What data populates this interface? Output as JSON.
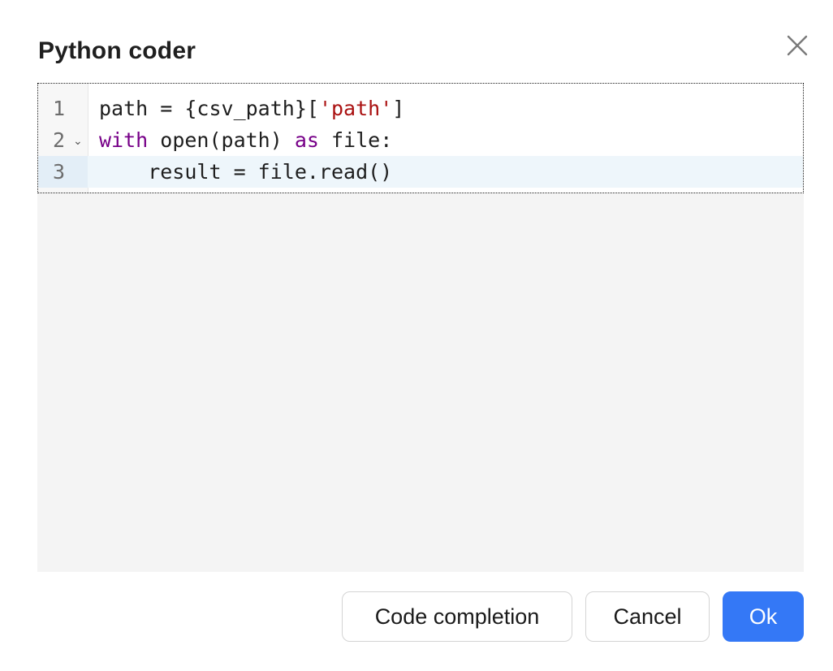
{
  "dialog": {
    "title": "Python coder",
    "close_icon": "close-icon"
  },
  "editor": {
    "active_line": 3,
    "lines": [
      {
        "number": "1",
        "foldable": false,
        "tokens": [
          {
            "text": "path = {csv_path}[",
            "type": "plain"
          },
          {
            "text": "'path'",
            "type": "string"
          },
          {
            "text": "]",
            "type": "plain"
          }
        ]
      },
      {
        "number": "2",
        "foldable": true,
        "tokens": [
          {
            "text": "with",
            "type": "keyword"
          },
          {
            "text": " open(path) ",
            "type": "plain"
          },
          {
            "text": "as",
            "type": "keyword"
          },
          {
            "text": " file:",
            "type": "plain"
          }
        ]
      },
      {
        "number": "3",
        "foldable": false,
        "tokens": [
          {
            "text": "    result = file.read()",
            "type": "plain"
          }
        ]
      }
    ],
    "fold_icon": "chevron-down-icon"
  },
  "buttons": {
    "code_completion": "Code completion",
    "cancel": "Cancel",
    "ok": "Ok"
  },
  "colors": {
    "primary": "#3478f6",
    "keyword": "#770088",
    "string": "#aa1111",
    "active_line": "#eef6fb"
  }
}
